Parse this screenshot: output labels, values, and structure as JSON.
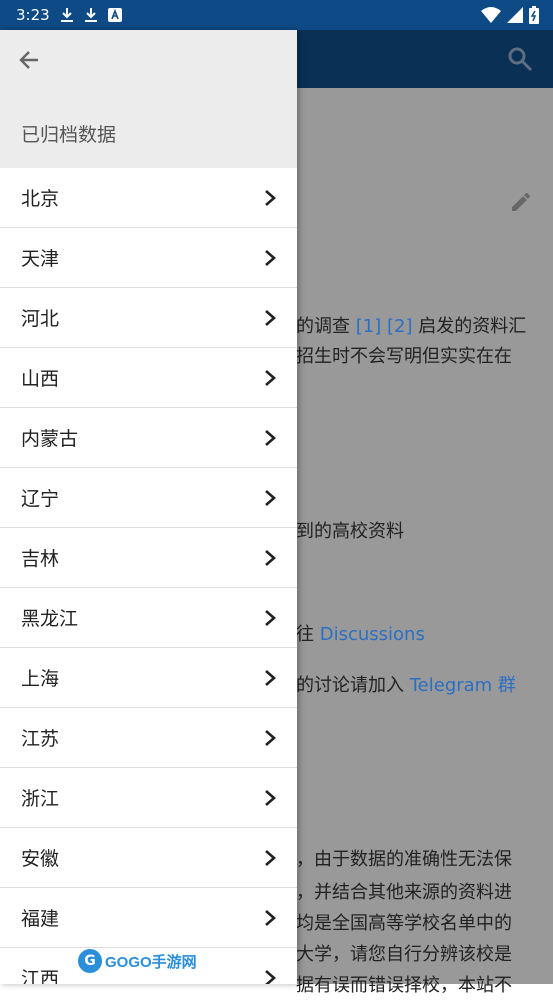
{
  "status_bar": {
    "time": "3:23"
  },
  "drawer": {
    "title": "已归档数据",
    "items": [
      {
        "label": "北京"
      },
      {
        "label": "天津"
      },
      {
        "label": "河北"
      },
      {
        "label": "山西"
      },
      {
        "label": "内蒙古"
      },
      {
        "label": "辽宁"
      },
      {
        "label": "吉林"
      },
      {
        "label": "黑龙江"
      },
      {
        "label": "上海"
      },
      {
        "label": "江苏"
      },
      {
        "label": "浙江"
      },
      {
        "label": "安徽"
      },
      {
        "label": "福建"
      },
      {
        "label": "江西"
      }
    ]
  },
  "background": {
    "p1a_text": "的调查 ",
    "p1a_link1": "[1]",
    "p1a_link2": "[2]",
    "p1a_rest": " 启发的资料汇",
    "p1b": "招生时不会写明但实实在在",
    "p2": "到的高校资料",
    "p3_text": "往 ",
    "p3_link": "Discussions",
    "p4_text": "的讨论请加入 ",
    "p4_link": "Telegram 群",
    "p5": "，由于数据的准确性无法保",
    "p6": "，并结合其他来源的资料进",
    "p7": "均是全国高等学校名单中的",
    "p8": "大学，请您自行分辨该校是",
    "p9": "据有误而错误择校，本站不"
  },
  "watermark": {
    "logo_text": "GOGO手游网"
  }
}
